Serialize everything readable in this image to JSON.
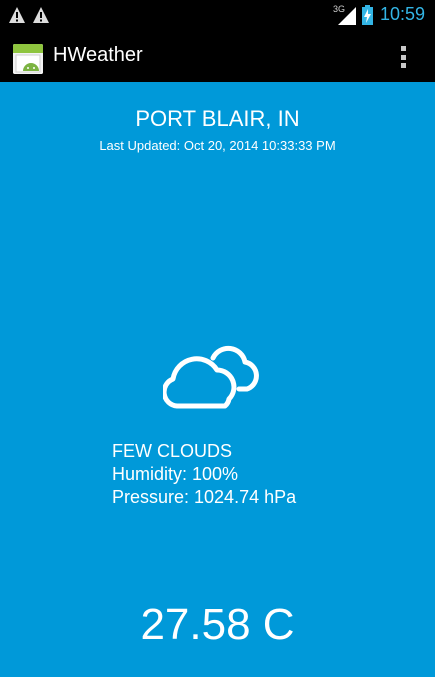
{
  "status_bar": {
    "network_type": "3G",
    "time": "10:59",
    "icons": [
      "warning-icon",
      "warning-icon",
      "signal-icon",
      "battery-charging-icon"
    ],
    "clock_color": "#33b5e5"
  },
  "action_bar": {
    "title": "HWeather",
    "app_icon": "android-app-icon",
    "menu_icon": "overflow-menu-icon"
  },
  "weather": {
    "city": "PORT BLAIR, IN",
    "last_updated": "Last Updated: Oct 20, 2014 10:33:33 PM",
    "icon": "cloud-icon",
    "description": "FEW CLOUDS",
    "humidity": "Humidity: 100%",
    "pressure": "Pressure: 1024.74 hPa",
    "temperature": "27.58 C"
  },
  "colors": {
    "background": "#0099d9",
    "bars": "#000000",
    "text": "#ffffff"
  }
}
